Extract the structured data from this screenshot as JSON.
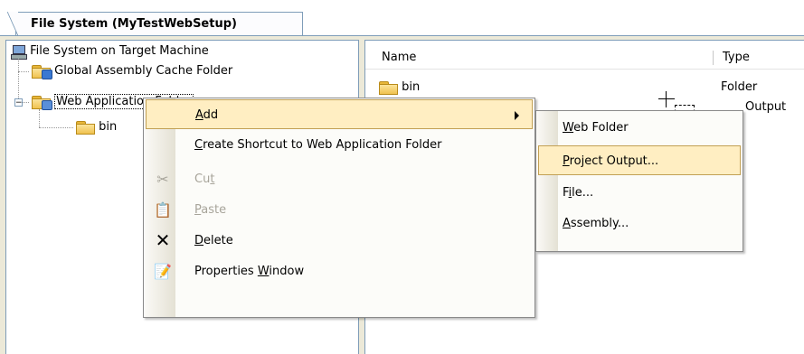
{
  "tab": {
    "title": "File System (MyTestWebSetup)"
  },
  "tree": {
    "root": "File System on Target Machine",
    "items": [
      {
        "label": "Global Assembly Cache Folder",
        "icon": "gac-folder-icon"
      },
      {
        "label": "Web Application Folder",
        "icon": "web-folder-icon",
        "expanded": true
      },
      {
        "label": "bin",
        "icon": "folder-icon"
      }
    ]
  },
  "list": {
    "columns": [
      "Name",
      "Type"
    ],
    "rows": [
      {
        "name": "bin",
        "type": "Folder"
      },
      {
        "name": "",
        "type": "Output"
      }
    ]
  },
  "context_menu": {
    "items": [
      {
        "label": "Add",
        "accel": "A",
        "rest": "dd",
        "submenu": true,
        "highlighted": true
      },
      {
        "label": "Create Shortcut to Web Application Folder",
        "pre": "",
        "accel": "C",
        "rest": "reate Shortcut to Web Application Folder"
      },
      {
        "label": "Cut",
        "pre": "Cu",
        "accel": "t",
        "rest": "",
        "disabled": true,
        "icon": "scissors-icon"
      },
      {
        "label": "Paste",
        "pre": "",
        "accel": "P",
        "rest": "aste",
        "disabled": true,
        "icon": "paste-icon"
      },
      {
        "label": "Delete",
        "pre": "",
        "accel": "D",
        "rest": "elete",
        "icon": "delete-icon"
      },
      {
        "label": "Properties Window",
        "pre": "Properties ",
        "accel": "W",
        "rest": "indow",
        "icon": "properties-icon"
      }
    ]
  },
  "submenu": {
    "items": [
      {
        "label": "Web Folder",
        "pre": "",
        "accel": "W",
        "rest": "eb Folder"
      },
      {
        "label": "Project Output...",
        "pre": "",
        "accel": "P",
        "rest": "roject Output...",
        "highlighted": true
      },
      {
        "label": "File...",
        "pre": "F",
        "accel": "i",
        "rest": "le..."
      },
      {
        "label": "Assembly...",
        "pre": "",
        "accel": "A",
        "rest": "ssembly..."
      }
    ]
  },
  "colors": {
    "highlight_bg": "#ffeec2",
    "highlight_border": "#c2a054",
    "pane_border": "#7f9db9",
    "frame_bg": "#ece9d8"
  }
}
